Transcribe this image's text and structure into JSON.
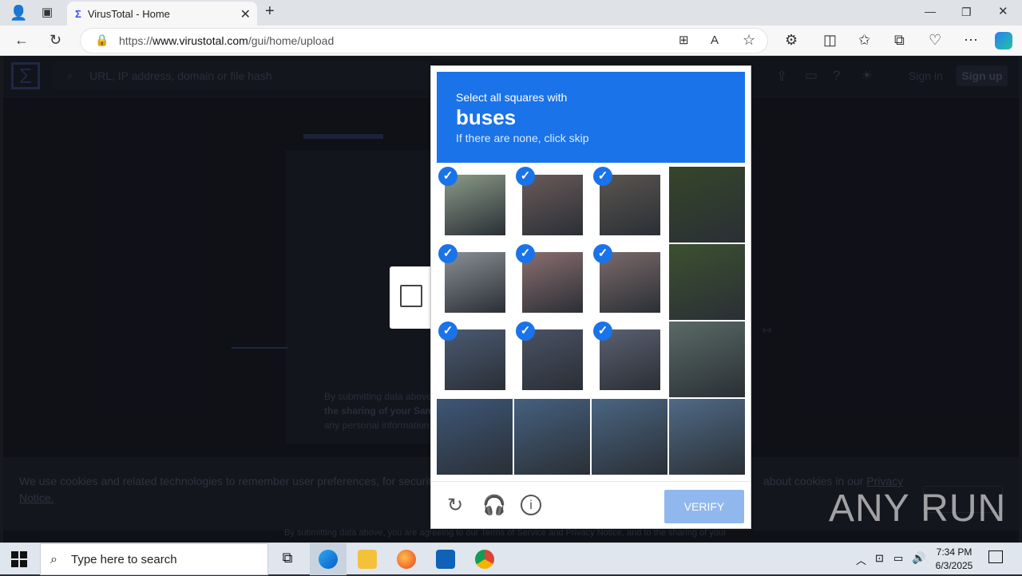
{
  "browser": {
    "tab_title": "VirusTotal - Home",
    "url_prefix": "https://",
    "url_domain": "www.virustotal.com",
    "url_path": "/gui/home/upload"
  },
  "virustotal": {
    "search_placeholder": "URL, IP address, domain or file hash",
    "sign_in": "Sign in",
    "sign_up": "Sign up",
    "submit_text_1": "By submitting data above,",
    "submit_text_2": "the sharing of your Sampl",
    "submit_text_3": "any personal information,",
    "bottom_text": "By submitting data above, you are agreeing to our Terms of Service and Privacy Notice, and to the sharing of your"
  },
  "cookie": {
    "text": "We use cookies and related technologies to remember user preferences, for security, to",
    "text_right": "about cookies in our",
    "privacy_link": "Privacy",
    "notice_link": "Notice."
  },
  "captcha": {
    "prompt": "Select all squares with",
    "target": "buses",
    "hint": "If there are none, click skip",
    "verify_label": "VERIFY",
    "tiles": [
      {
        "selected": true,
        "color": "#8a9a88"
      },
      {
        "selected": true,
        "color": "#6a5a5a"
      },
      {
        "selected": true,
        "color": "#5a5550"
      },
      {
        "selected": false,
        "color": "#35462a"
      },
      {
        "selected": true,
        "color": "#8a8f96"
      },
      {
        "selected": true,
        "color": "#8b6e70"
      },
      {
        "selected": true,
        "color": "#7b6a6a"
      },
      {
        "selected": false,
        "color": "#3c5030"
      },
      {
        "selected": true,
        "color": "#4a5a72"
      },
      {
        "selected": true,
        "color": "#4a5264"
      },
      {
        "selected": true,
        "color": "#5a6070"
      },
      {
        "selected": false,
        "color": "#5a6a66"
      },
      {
        "selected": false,
        "color": "#3e5677"
      },
      {
        "selected": false,
        "color": "#45607f"
      },
      {
        "selected": false,
        "color": "#4a6582"
      },
      {
        "selected": false,
        "color": "#506a86"
      }
    ]
  },
  "taskbar": {
    "search_placeholder": "Type here to search",
    "time": "7:34 PM",
    "date": "6/3/2025"
  },
  "watermark": "ANY RUN"
}
